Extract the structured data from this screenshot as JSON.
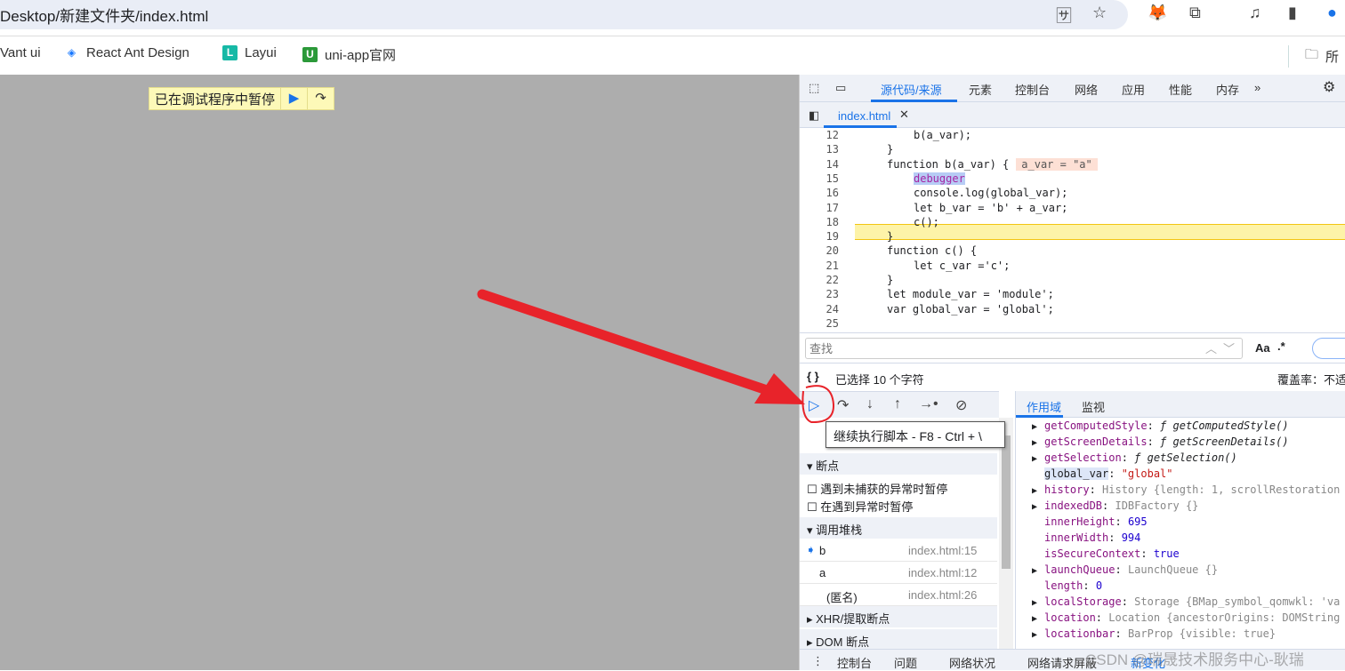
{
  "browser": {
    "address": "Desktop/新建文件夹/index.html",
    "bookmarks": [
      "Vant ui",
      "React Ant Design",
      "Layui",
      "uni-app官网"
    ],
    "bookmarks_folder": "所"
  },
  "page": {
    "paused_banner": "已在调试程序中暂停"
  },
  "devtools": {
    "tabs": [
      "源代码/来源",
      "元素",
      "控制台",
      "网络",
      "应用",
      "性能",
      "内存"
    ],
    "active_tab": "源代码/来源",
    "file_tab": "index.html",
    "code": [
      {
        "n": "12",
        "t": "b(a_var);"
      },
      {
        "n": "13",
        "t": "}"
      },
      {
        "n": "14",
        "t": "function b(a_var) {",
        "inline": "a_var = \"a\""
      },
      {
        "n": "15",
        "t": "debugger"
      },
      {
        "n": "16",
        "t": "console.log(global_var);"
      },
      {
        "n": "17",
        "t": "let b_var = 'b' + a_var;"
      },
      {
        "n": "18",
        "t": "c();"
      },
      {
        "n": "19",
        "t": "}"
      },
      {
        "n": "20",
        "t": "function c() {"
      },
      {
        "n": "21",
        "t": "let c_var ='c';"
      },
      {
        "n": "22",
        "t": "}"
      },
      {
        "n": "23",
        "t": "let module_var = 'module';"
      },
      {
        "n": "24",
        "t": "var global_var = 'global';"
      },
      {
        "n": "25",
        "t": ""
      }
    ],
    "search_placeholder": "查找",
    "match_case": "Aa",
    "regex": ".*",
    "status": "已选择 10 个字符",
    "coverage": "覆盖率：不适",
    "tooltip": "继续执行脚本 - F8 - Ctrl + \\",
    "breakpoints_title": "断点",
    "checkbox_uncaught": "遇到未捕获的异常时暂停",
    "checkbox_caught": "在遇到异常时暂停",
    "callstack_title": "调用堆栈",
    "callstack": [
      {
        "fn": "b",
        "loc": "index.html:15"
      },
      {
        "fn": "a",
        "loc": "index.html:12"
      },
      {
        "fn": "(匿名)",
        "loc": "index.html:26"
      }
    ],
    "xhr_title": "XHR/提取断点",
    "dom_title": "DOM 断点",
    "right_tabs": [
      "作用域",
      "监视"
    ],
    "scope": [
      {
        "k": "getComputedStyle",
        "v": "ƒ getComputedStyle()",
        "exp": true
      },
      {
        "k": "getScreenDetails",
        "v": "ƒ getScreenDetails()",
        "exp": true
      },
      {
        "k": "getSelection",
        "v": "ƒ getSelection()",
        "exp": true
      },
      {
        "k": "global_var",
        "v": "\"global\"",
        "exp": false
      },
      {
        "k": "history",
        "v": "History {length: 1, scrollRestoration",
        "exp": true
      },
      {
        "k": "indexedDB",
        "v": "IDBFactory {}",
        "exp": true
      },
      {
        "k": "innerHeight",
        "v": "695",
        "exp": false
      },
      {
        "k": "innerWidth",
        "v": "994",
        "exp": false
      },
      {
        "k": "isSecureContext",
        "v": "true",
        "exp": false
      },
      {
        "k": "launchQueue",
        "v": "LaunchQueue {}",
        "exp": true
      },
      {
        "k": "length",
        "v": "0",
        "exp": false
      },
      {
        "k": "localStorage",
        "v": "Storage {BMap_symbol_qomwkl: 'va",
        "exp": true
      },
      {
        "k": "location",
        "v": "Location {ancestorOrigins: DOMString",
        "exp": true
      },
      {
        "k": "locationbar",
        "v": "BarProp {visible: true}",
        "exp": true
      }
    ],
    "drawer_tabs": [
      "控制台",
      "问题",
      "网络状况",
      "网络请求屏蔽",
      "新变化"
    ]
  },
  "watermark": "CSDN @瑞晟技术服务中心-耿瑞",
  "colors": {
    "accent": "#1a73e8",
    "annotation": "#e8232a",
    "paused_line": "#fdf3a8"
  }
}
